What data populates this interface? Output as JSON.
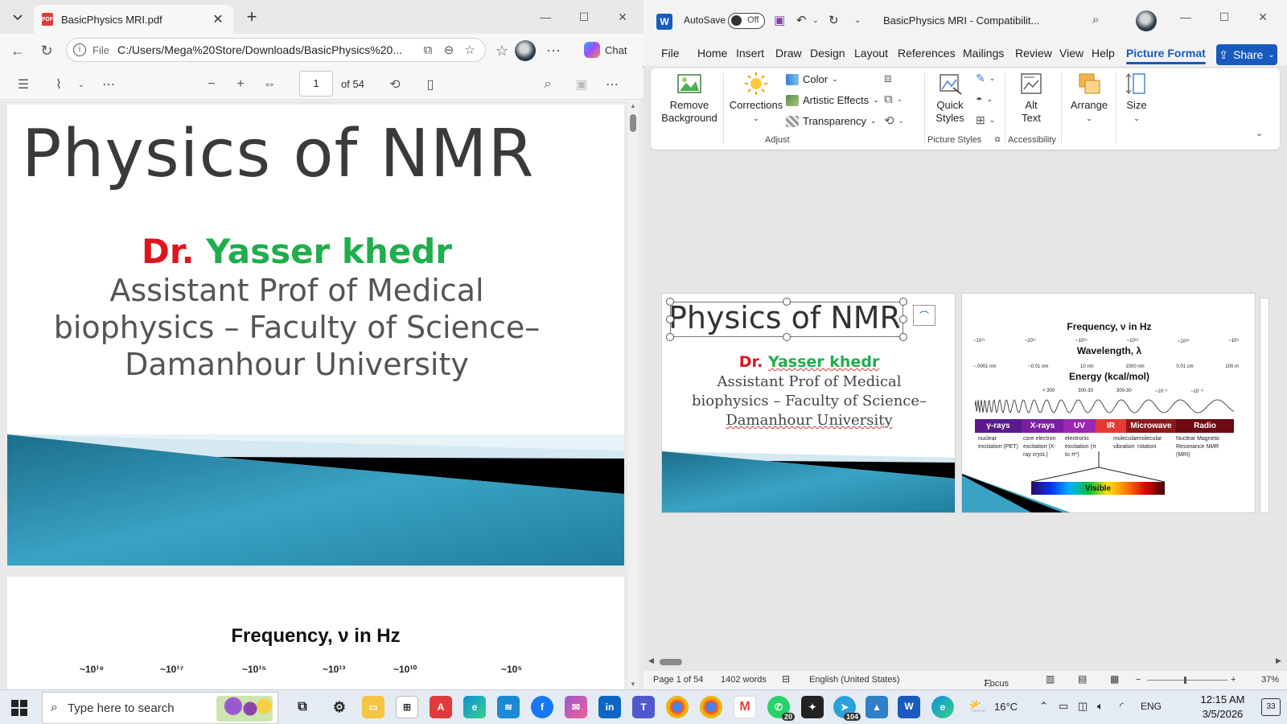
{
  "edge": {
    "tab_title": "BasicPhysics MRI.pdf",
    "url_scheme": "File",
    "url": "C:/Users/Mega%20Store/Downloads/BasicPhysics%20...",
    "chat_label": "Chat",
    "pdf_toolbar": {
      "page_current": "1",
      "page_total": "of 54"
    }
  },
  "pdf_slide1": {
    "title": "Physics of NMR",
    "author_prefix": "Dr.",
    "author_name": "Yasser khedr",
    "affiliation_line1": "Assistant Prof of Medical",
    "affiliation_line2": "biophysics – Faculty of Science–",
    "affiliation_line3": "Damanhour University"
  },
  "pdf_slide2": {
    "title": "Frequency, ν in Hz",
    "ticks": [
      "~10¹⁹",
      "~10¹⁷",
      "~10¹⁵",
      "~10¹³",
      "~10¹⁰",
      "~10⁵"
    ]
  },
  "word": {
    "autosave_label": "AutoSave",
    "autosave_state": "Off",
    "doc_title": "BasicPhysics MRI  -  Compatibilit...",
    "menu": [
      "File",
      "Home",
      "Insert",
      "Draw",
      "Design",
      "Layout",
      "References",
      "Mailings",
      "Review",
      "View",
      "Help",
      "Picture Format"
    ],
    "share_label": "Share",
    "ribbon": {
      "remove_background": "Remove Background",
      "corrections": "Corrections",
      "color": "Color",
      "artistic_effects": "Artistic Effects",
      "transparency": "Transparency",
      "adjust_group": "Adjust",
      "quick_styles": "Quick Styles",
      "picture_styles_group": "Picture Styles",
      "alt_text": "Alt Text",
      "accessibility_group": "Accessibility",
      "arrange": "Arrange",
      "size": "Size"
    },
    "thumb_slide1": {
      "title": "Physics of NMR",
      "author_prefix": "Dr.",
      "author_name": "Yasser khedr",
      "affiliation_line1": "Assistant Prof of Medical",
      "affiliation_line2": "biophysics – Faculty of Science–",
      "affiliation_line3": "Damanhour University"
    },
    "thumb_slide2": {
      "title": "Frequency, ν in Hz",
      "freq_ticks": [
        "~10¹⁹",
        "~10¹⁷",
        "~10¹⁵",
        "~10¹³",
        "~10¹⁰",
        "~10⁵"
      ],
      "wavelength_label": "Wavelength, λ",
      "wavelength_ticks": [
        "~.0001 nm",
        "~0.01 nm",
        "10 nm",
        "1000 nm",
        "0.01 cm",
        "100 m"
      ],
      "energy_label": "Energy (kcal/mol)",
      "energy_ticks": [
        "> 300",
        "300-30",
        "300-30",
        "~10⁻³",
        "~10⁻⁶"
      ],
      "bands": [
        "γ-rays",
        "X-rays",
        "UV",
        "IR",
        "Microwave",
        "Radio"
      ],
      "band_colors": [
        "#5a1a8c",
        "#7b1fa2",
        "#9c27b0",
        "#e53935",
        "#8b1a1a",
        "#6d0a14"
      ],
      "descriptions": [
        "nuclear excitation (PET)",
        "core electron excitation (X-ray cryst.)",
        "electronic excitation (π to π*)",
        "molecular vibration",
        "molecular rotation",
        "Nuclear Magnetic Resonance NMR (MRI)"
      ],
      "visible_label": "Visible"
    },
    "status": {
      "page": "Page 1 of 54",
      "words": "1402 words",
      "language": "English (United States)",
      "focus": "Focus",
      "zoom": "37%"
    }
  },
  "taskbar": {
    "search_placeholder": "Type here to search",
    "weather": "16°C",
    "language": "ENG",
    "time": "12:15 AM",
    "date": "3/5/2026",
    "notification_count": "33",
    "whatsapp_badge": "20",
    "telegram_badge": "104"
  }
}
